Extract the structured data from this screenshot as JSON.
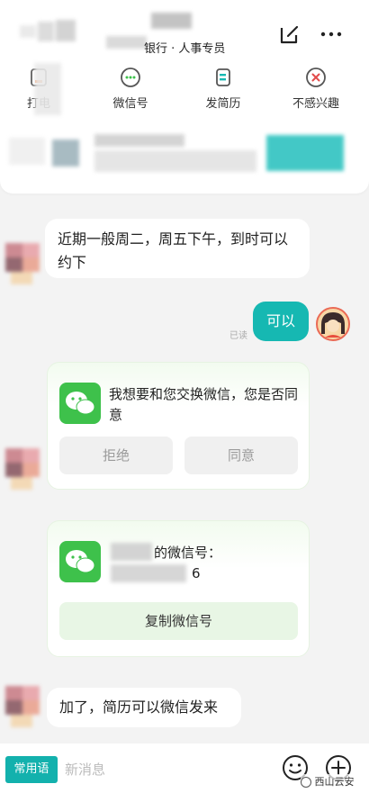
{
  "header": {
    "title_suffix": "银行 · 人事专员"
  },
  "actions": [
    {
      "label": "打电",
      "icon": "phone-icon"
    },
    {
      "label": "微信号",
      "icon": "wechat-icon"
    },
    {
      "label": "发简历",
      "icon": "resume-icon"
    },
    {
      "label": "不感兴趣",
      "icon": "not-interested-icon"
    }
  ],
  "messages": {
    "m1": "近期一般周二，周五下午，到时可以约下",
    "m2": "可以",
    "read_status": "已读",
    "m3_card_text": "我想要和您交换微信，您是否同意",
    "reject_label": "拒绝",
    "agree_label": "同意",
    "m4_card_text_a": "的微信号：",
    "m4_card_text_b": "6",
    "copy_wechat_label": "复制微信号",
    "m5": "加了，简历可以微信发来"
  },
  "input": {
    "common_phrases": "常用语",
    "placeholder": "新消息"
  },
  "watermark": "西山云安",
  "colors": {
    "accent": "#16b8b2",
    "wechat_green": "#3ec14b"
  }
}
